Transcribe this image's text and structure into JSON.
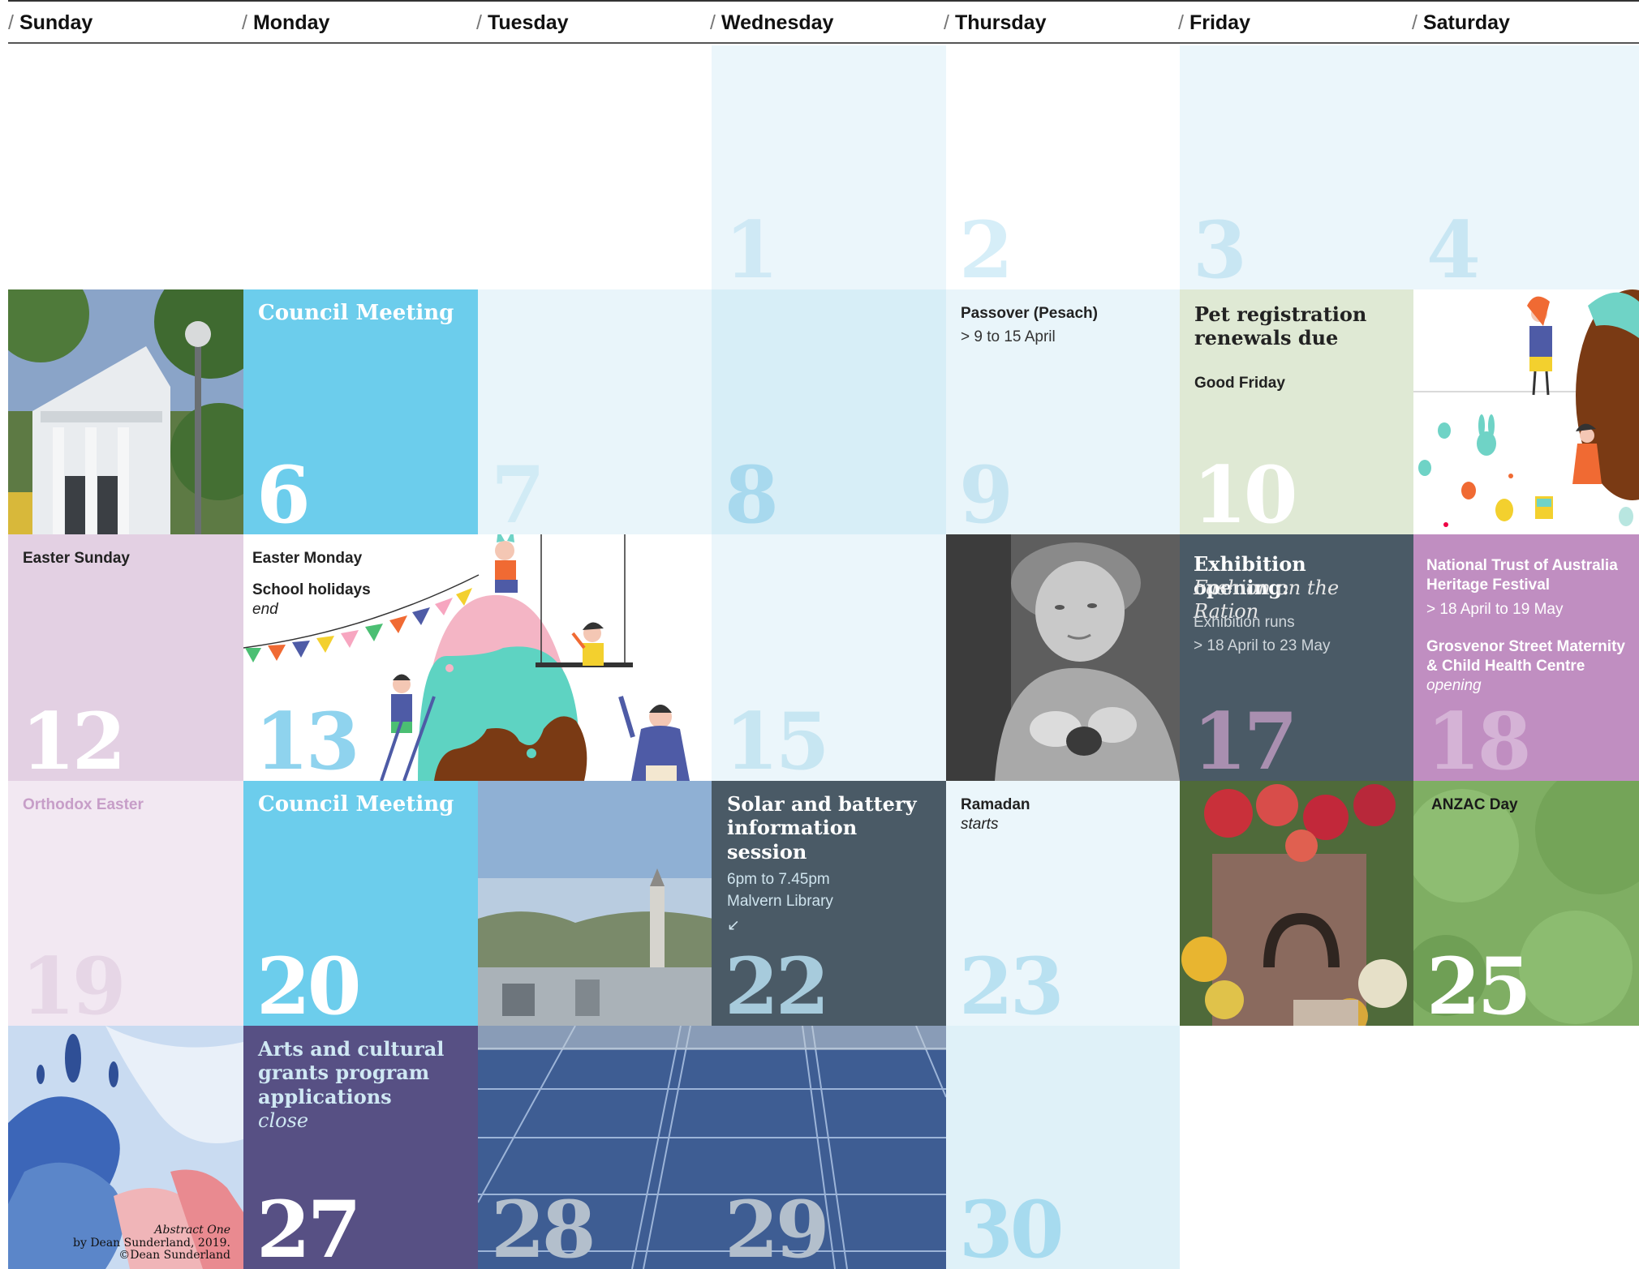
{
  "days": [
    "Sunday",
    "Monday",
    "Tuesday",
    "Wednesday",
    "Thursday",
    "Friday",
    "Saturday"
  ],
  "nums": {
    "d1": "1",
    "d2": "2",
    "d3": "3",
    "d4": "4",
    "d6": "6",
    "d7": "7",
    "d8": "8",
    "d9": "9",
    "d10": "10",
    "d12": "12",
    "d13": "13",
    "d15": "15",
    "d17": "17",
    "d18": "18",
    "d19": "19",
    "d20": "20",
    "d22": "22",
    "d23": "23",
    "d25": "25",
    "d27": "27",
    "d28": "28",
    "d29": "29",
    "d30": "30"
  },
  "events": {
    "council_6": "Council Meeting",
    "passover": "Passover (Pesach)",
    "passover_dates": "> 9 to 15 April",
    "pet_rego": "Pet registration renewals due",
    "good_friday": "Good Friday",
    "easter_sunday": "Easter Sunday",
    "easter_monday": "Easter Monday",
    "school_holidays": "School holidays",
    "school_holidays_end": "end",
    "exhibition_title": "Exhibition opening:",
    "exhibition_subtitle": "Fashion on the Ration",
    "exhibition_runs": "Exhibition runs",
    "exhibition_dates": "> 18 April to 23 May",
    "heritage_festival": "National Trust of Australia Heritage Festival",
    "heritage_dates": "> 18 April to 19 May",
    "grosvenor": "Grosvenor Street Maternity & Child Health Centre",
    "grosvenor_opening": "opening",
    "orthodox_easter": "Orthodox Easter",
    "council_20": "Council Meeting",
    "solar_title": "Solar and battery information session",
    "solar_time": "6pm to 7.45pm",
    "solar_place": "Malvern Library",
    "solar_arrow": "↙",
    "ramadan": "Ramadan",
    "ramadan_starts": "starts",
    "anzac": "ANZAC Day",
    "arts_title": "Arts and cultural grants program applications",
    "arts_close": "close"
  },
  "credit": {
    "title": "Abstract One",
    "by": "by Dean Sunderland, 2019.",
    "copyright": "©Dean Sunderland"
  },
  "colors": {
    "light_blue": "#ebf6fb",
    "pale_blue": "#e9f5fa",
    "sky": "#6ccdec",
    "pale_green": "#dfe9d4",
    "mauve": "#e3d0e3",
    "pale_mauve": "#f2e8f2",
    "slate": "#4a5a66",
    "purple": "#c08ec1",
    "indigo": "#575084",
    "green": "#7fae63"
  }
}
